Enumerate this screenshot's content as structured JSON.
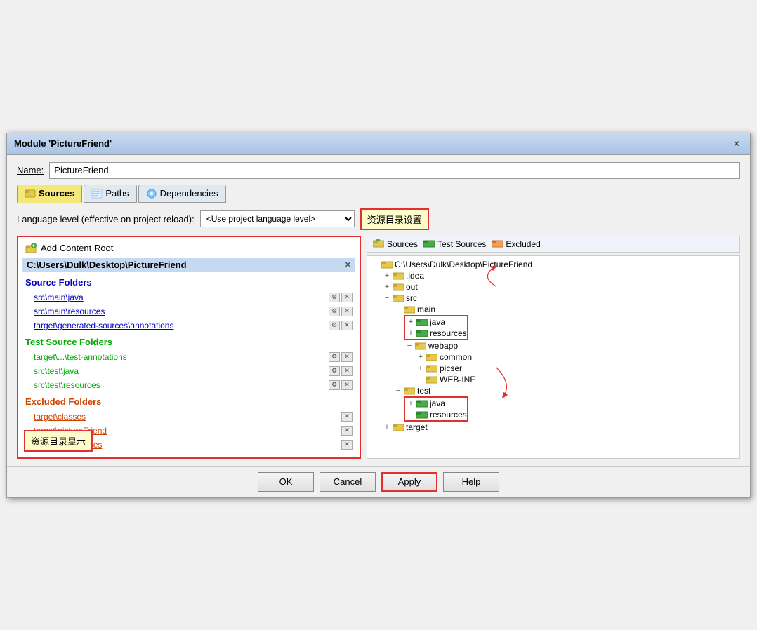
{
  "dialog": {
    "title": "Module 'PictureFriend'",
    "close_label": "✕"
  },
  "name_row": {
    "label": "Name:",
    "value": "PictureFriend"
  },
  "tabs": [
    {
      "id": "sources",
      "label": "Sources",
      "active": true
    },
    {
      "id": "paths",
      "label": "Paths",
      "active": false
    },
    {
      "id": "dependencies",
      "label": "Dependencies",
      "active": false
    }
  ],
  "language_level": {
    "label": "Language level (effective on project reload):",
    "value": "<Use project language level>"
  },
  "annotation_right": "资源目录设置",
  "left_panel": {
    "add_content_root": "Add Content Root",
    "content_root_path": "C:\\Users\\Dulk\\Desktop\\PictureFriend",
    "source_folders_label": "Source Folders",
    "source_folders": [
      "src\\main\\java",
      "src\\main\\resources",
      "target\\generated-sources\\annotations"
    ],
    "test_source_folders_label": "Test Source Folders",
    "test_source_folders": [
      "target\\...\\test-annotations",
      "src\\test\\java",
      "src\\test\\resources"
    ],
    "excluded_folders_label": "Excluded Folders",
    "excluded_folders": [
      "target\\classes",
      "target\\pictureFriend",
      "target\\test-classes"
    ],
    "bottom_label": "资源目录显示"
  },
  "legend": {
    "sources_label": "Sources",
    "test_sources_label": "Test Sources",
    "excluded_label": "Excluded"
  },
  "tree": {
    "root": "C:\\Users\\Dulk\\Desktop\\PictureFriend",
    "nodes": [
      {
        "name": ".idea",
        "level": 1,
        "type": "normal",
        "expanded": false
      },
      {
        "name": "out",
        "level": 1,
        "type": "normal",
        "expanded": false
      },
      {
        "name": "src",
        "level": 1,
        "type": "normal",
        "expanded": true
      },
      {
        "name": "main",
        "level": 2,
        "type": "normal",
        "expanded": true
      },
      {
        "name": "java",
        "level": 3,
        "type": "source",
        "expanded": false,
        "highlighted": true
      },
      {
        "name": "resources",
        "level": 3,
        "type": "source",
        "expanded": false,
        "highlighted": true
      },
      {
        "name": "webapp",
        "level": 3,
        "type": "normal",
        "expanded": true
      },
      {
        "name": "common",
        "level": 4,
        "type": "normal",
        "expanded": false
      },
      {
        "name": "picser",
        "level": 4,
        "type": "normal",
        "expanded": false
      },
      {
        "name": "WEB-INF",
        "level": 4,
        "type": "normal",
        "expanded": false
      },
      {
        "name": "test",
        "level": 2,
        "type": "normal",
        "expanded": true
      },
      {
        "name": "java",
        "level": 3,
        "type": "test",
        "expanded": false,
        "highlighted": true
      },
      {
        "name": "resources",
        "level": 3,
        "type": "test",
        "expanded": false,
        "highlighted": true
      },
      {
        "name": "target",
        "level": 1,
        "type": "normal",
        "expanded": false
      }
    ]
  },
  "buttons": {
    "ok": "OK",
    "cancel": "Cancel",
    "apply": "Apply",
    "help": "Help"
  }
}
